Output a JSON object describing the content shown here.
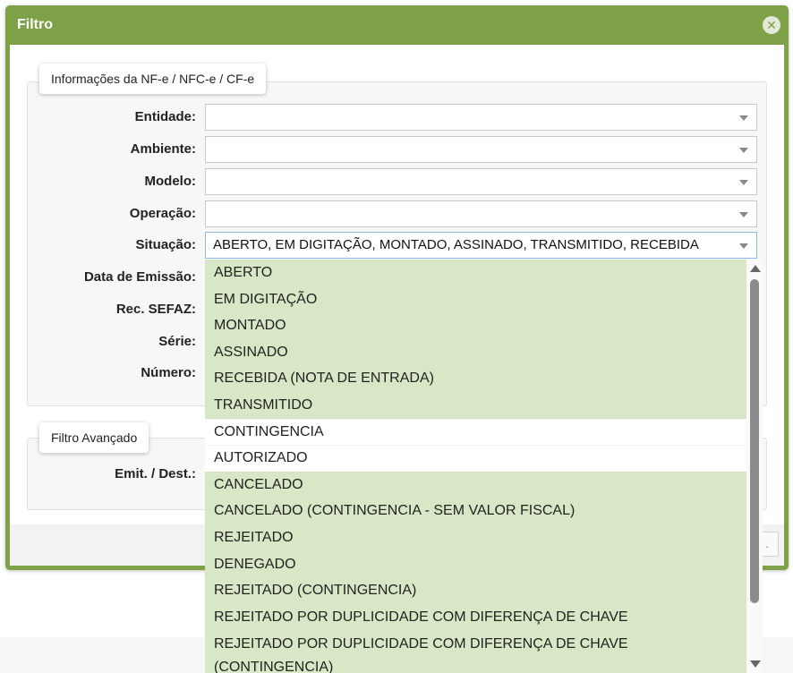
{
  "dialog": {
    "title": "Filtro",
    "close_icon": "close-icon"
  },
  "fieldset_main": {
    "legend": "Informações da NF-e / NFC-e / CF-e",
    "fields": [
      {
        "label": "Entidade:",
        "value": ""
      },
      {
        "label": "Ambiente:",
        "value": ""
      },
      {
        "label": "Modelo:",
        "value": ""
      },
      {
        "label": "Operação:",
        "value": ""
      },
      {
        "label": "Situação:",
        "value": "ABERTO, EM DIGITAÇÃO, MONTADO, ASSINADO, TRANSMITIDO, RECEBIDA"
      },
      {
        "label": "Data de Emissão:"
      },
      {
        "label": "Rec. SEFAZ:"
      },
      {
        "label": "Série:"
      },
      {
        "label": "Número:"
      }
    ]
  },
  "fieldset_advanced": {
    "legend": "Filtro Avançado",
    "fields": [
      {
        "label": "Emit. / Dest.:"
      }
    ]
  },
  "dropdown": {
    "options": [
      {
        "label": "ABERTO",
        "selected": true
      },
      {
        "label": "EM DIGITAÇÃO",
        "selected": true
      },
      {
        "label": "MONTADO",
        "selected": true
      },
      {
        "label": "ASSINADO",
        "selected": true
      },
      {
        "label": "RECEBIDA (NOTA DE ENTRADA)",
        "selected": true
      },
      {
        "label": "TRANSMITIDO",
        "selected": true
      },
      {
        "label": "CONTINGENCIA",
        "selected": false
      },
      {
        "label": "AUTORIZADO",
        "selected": false
      },
      {
        "label": "CANCELADO",
        "selected": true
      },
      {
        "label": "CANCELADO (CONTINGENCIA - SEM VALOR FISCAL)",
        "selected": true
      },
      {
        "label": "REJEITADO",
        "selected": true
      },
      {
        "label": "DENEGADO",
        "selected": true
      },
      {
        "label": "REJEITADO (CONTINGENCIA)",
        "selected": true
      },
      {
        "label": "REJEITADO POR DUPLICIDADE COM DIFERENÇA DE CHAVE",
        "selected": true
      },
      {
        "label": "REJEITADO POR DUPLICIDADE COM DIFERENÇA DE CHAVE (CONTINGENCIA)",
        "selected": true
      }
    ]
  },
  "colors": {
    "header": "#7ea046",
    "selected_option": "#d8e7c5"
  }
}
